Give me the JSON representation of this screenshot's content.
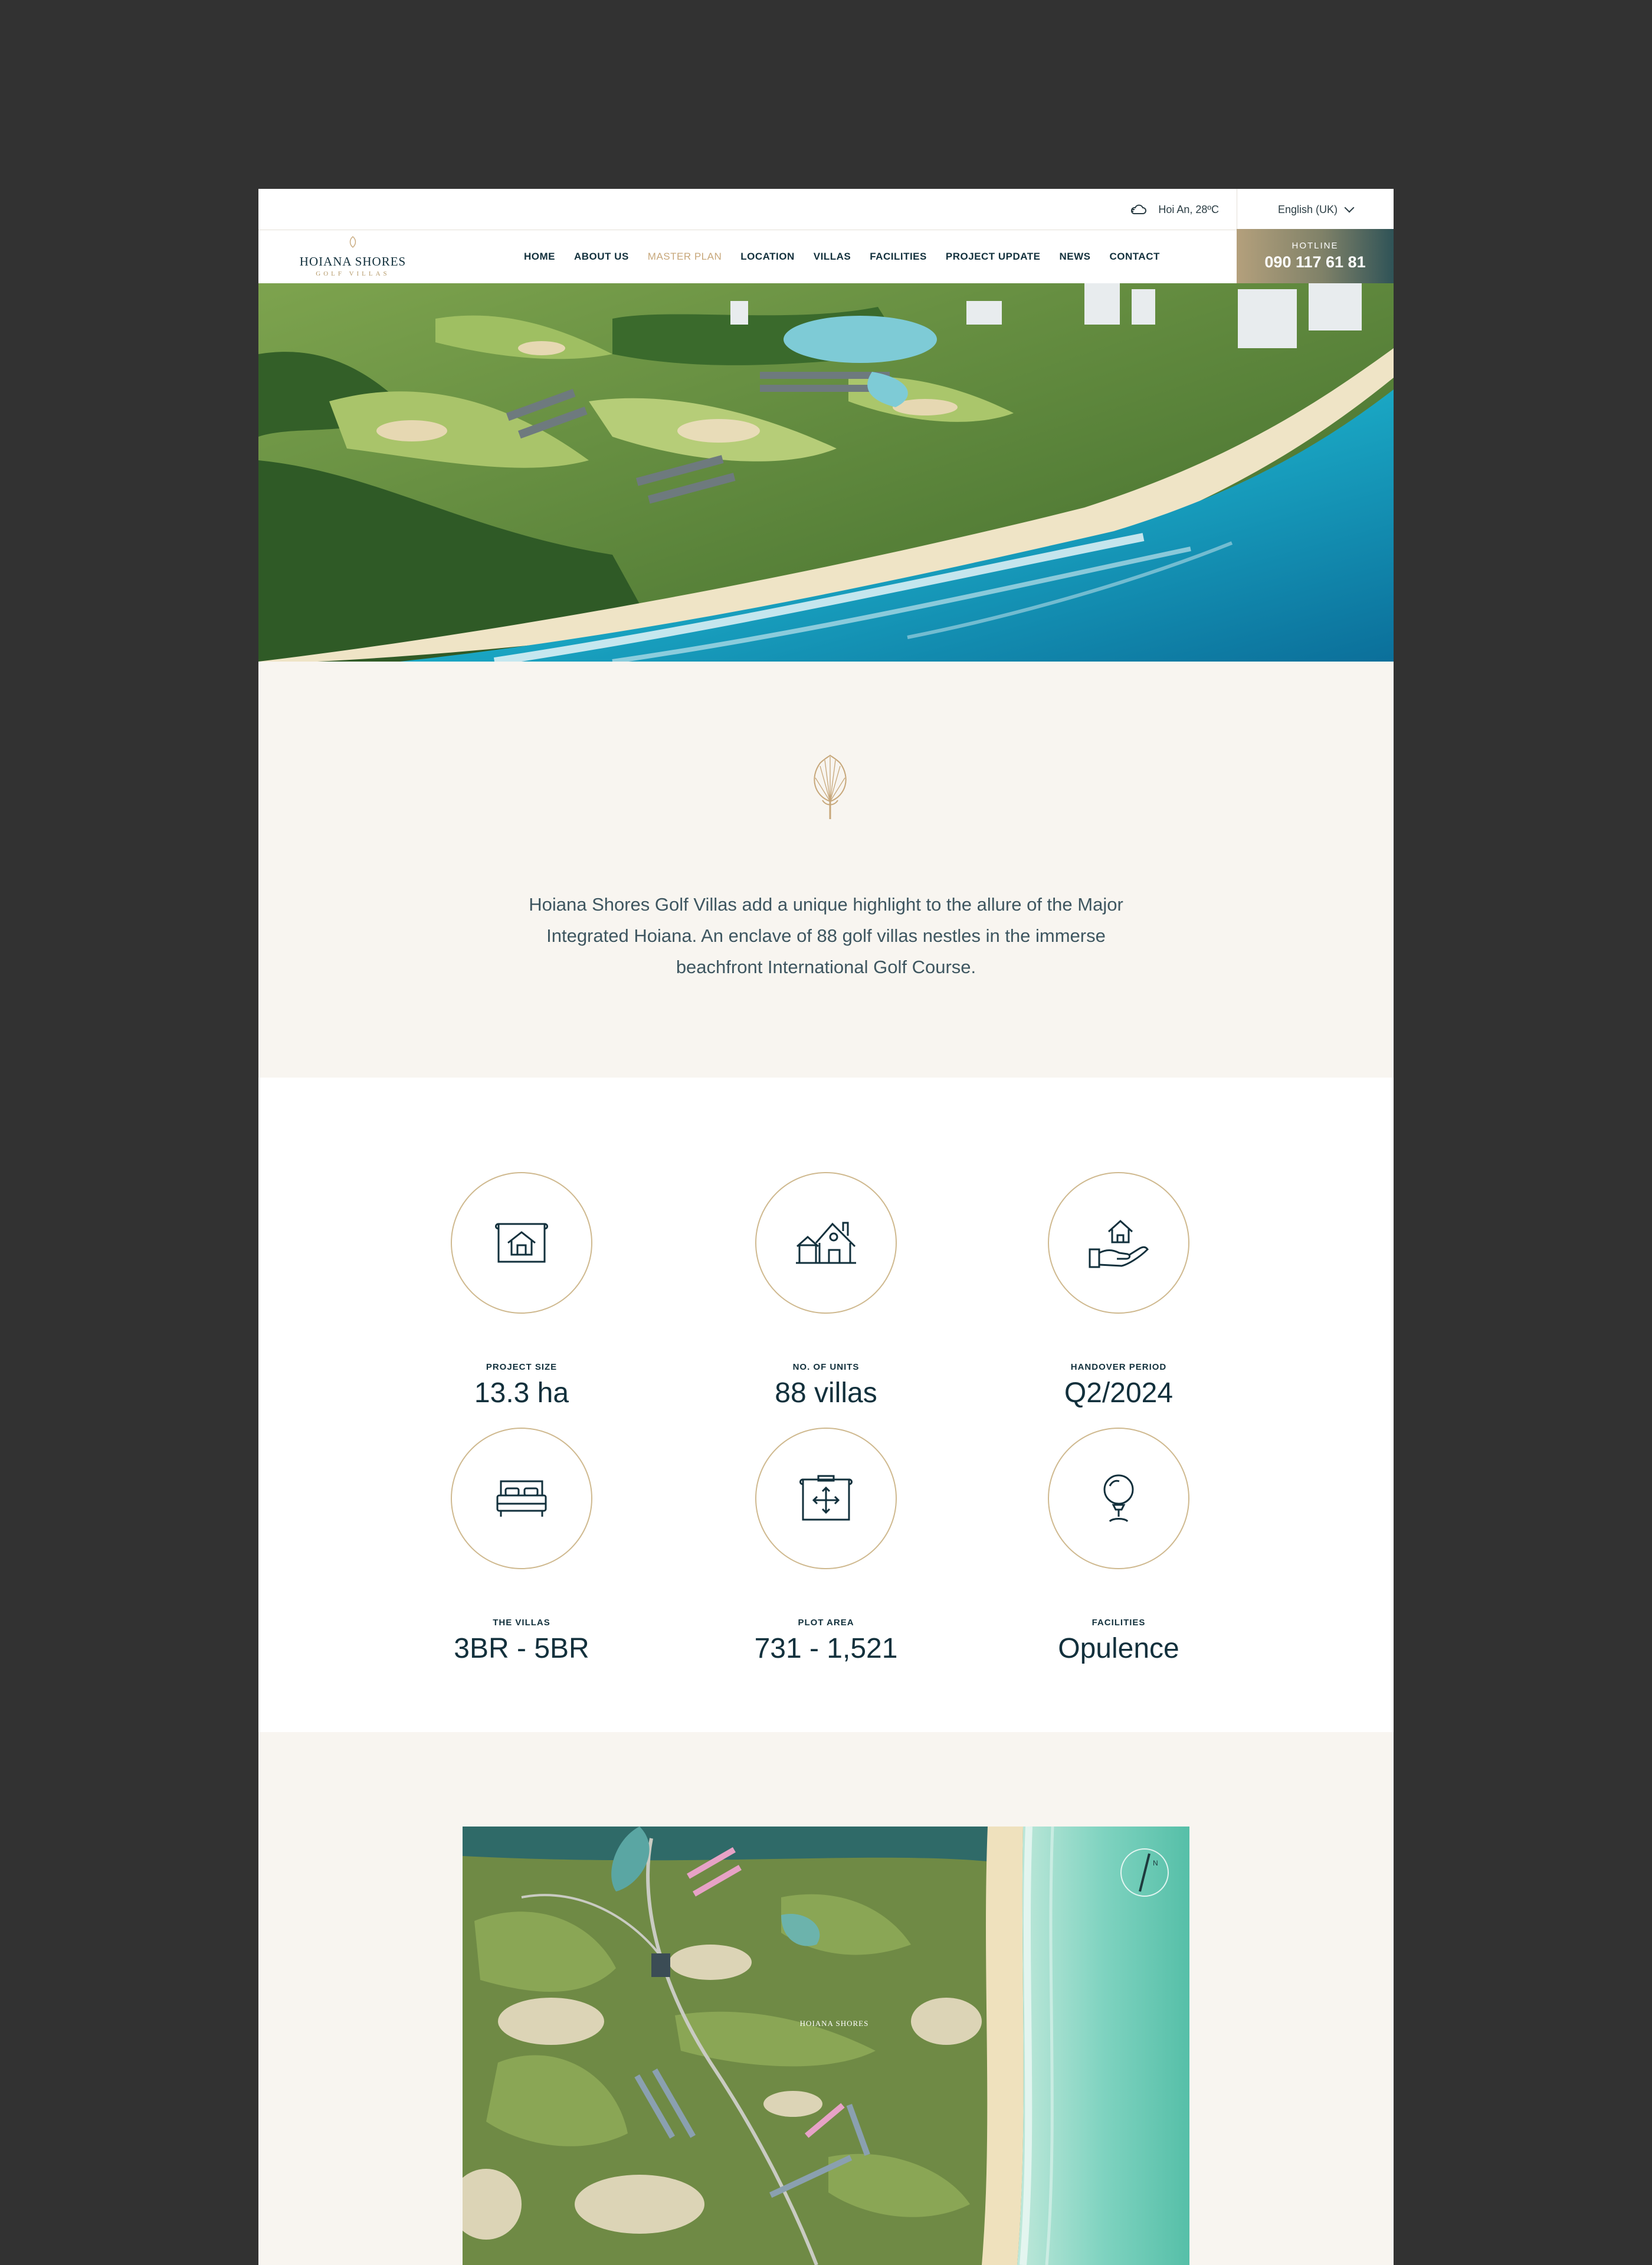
{
  "topbar": {
    "weather_icon": "cloud-icon",
    "weather": "Hoi An, 28ºC",
    "language": "English (UK)"
  },
  "brand": {
    "name": "HOIANA SHORES",
    "tagline": "GOLF VILLAS"
  },
  "nav": [
    {
      "label": "HOME",
      "active": false
    },
    {
      "label": "ABOUT US",
      "active": false
    },
    {
      "label": "MASTER PLAN",
      "active": true
    },
    {
      "label": "LOCATION",
      "active": false
    },
    {
      "label": "VILLAS",
      "active": false
    },
    {
      "label": "FACILITIES",
      "active": false
    },
    {
      "label": "PROJECT UPDATE",
      "active": false
    },
    {
      "label": "NEWS",
      "active": false
    },
    {
      "label": "CONTACT",
      "active": false
    }
  ],
  "hotline": {
    "label": "HOTLINE",
    "number": "090 117 61 81"
  },
  "hero": {
    "image": "aerial-beach-golf-resort"
  },
  "intro": {
    "icon": "palm-leaf-icon",
    "text": "Hoiana Shores Golf Villas add a unique highlight to the allure of the Major Integrated Hoiana. An enclave of 88 golf villas nestles in the immerse beachfront International Golf Course."
  },
  "stats": [
    {
      "icon": "blueprint-house-icon",
      "label": "PROJECT SIZE",
      "value": "13.3 ha"
    },
    {
      "icon": "house-icon",
      "label": "NO. OF UNITS",
      "value": "88 villas"
    },
    {
      "icon": "hand-house-icon",
      "label": "HANDOVER PERIOD",
      "value": "Q2/2024"
    },
    {
      "icon": "bed-icon",
      "label": "THE VILLAS",
      "value": "3BR - 5BR"
    },
    {
      "icon": "plot-area-icon",
      "label": "PLOT AREA",
      "value": "731 - 1,521"
    },
    {
      "icon": "golf-ball-icon",
      "label": "FACILITIES",
      "value": "Opulence"
    }
  ],
  "masterplan": {
    "image": "masterplan-aerial-map",
    "map_label": "HOIANA SHORES",
    "compass": "compass-icon"
  },
  "colors": {
    "background": "#323232",
    "cream": "#f8f5f0",
    "navy": "#12303c",
    "gold": "#c7a77a",
    "circle_border": "#cfb98f"
  }
}
